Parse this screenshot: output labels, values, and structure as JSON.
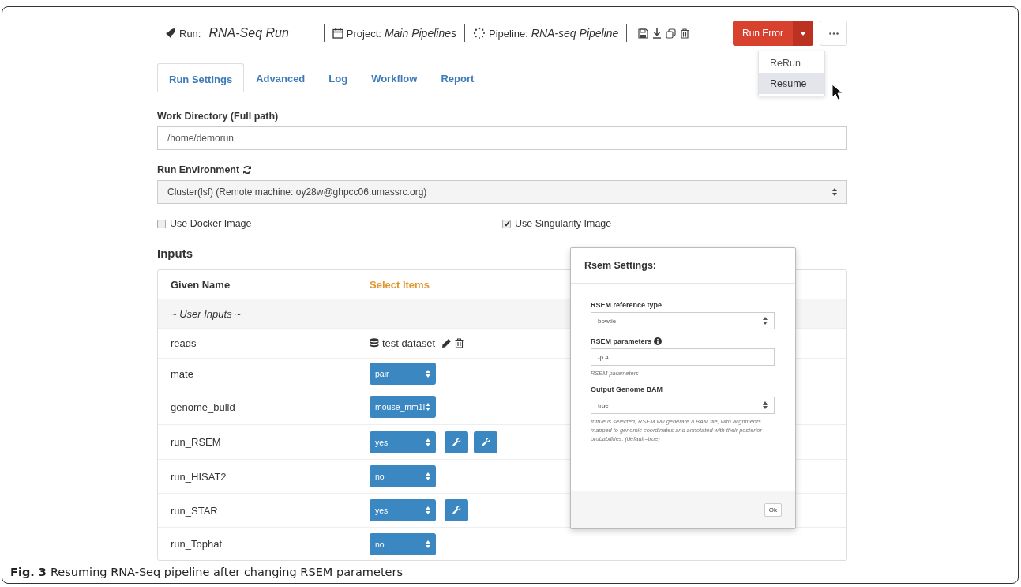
{
  "header": {
    "run_label": "Run:",
    "run_name": "RNA-Seq Run",
    "project_label": "Project:",
    "project_name": "Main Pipelines",
    "pipeline_label": "Pipeline:",
    "pipeline_name": "RNA-seq Pipeline"
  },
  "status_button": {
    "label": "Run Error"
  },
  "status_menu": {
    "expanded": true,
    "items": [
      {
        "label": "ReRun",
        "selected": false
      },
      {
        "label": "Resume",
        "selected": true
      }
    ]
  },
  "tabs": [
    {
      "label": "Run Settings",
      "selected": true
    },
    {
      "label": "Advanced",
      "selected": false
    },
    {
      "label": "Log",
      "selected": false
    },
    {
      "label": "Workflow",
      "selected": false
    },
    {
      "label": "Report",
      "selected": false
    }
  ],
  "work_directory": {
    "label": "Work Directory (Full path)",
    "value": "/home/demorun"
  },
  "run_environment": {
    "label": "Run Environment",
    "value": "Cluster(lsf) (Remote machine: oy28w@ghpcc06.umassrc.org)"
  },
  "options": [
    {
      "label": "Use Docker Image",
      "checked": false
    },
    {
      "label": "Use Singularity Image",
      "checked": true
    }
  ],
  "inputs": {
    "title": "Inputs",
    "columns": [
      "Given Name",
      "Select Items"
    ],
    "group": "~ User Inputs ~",
    "rows": [
      {
        "name": "reads",
        "kind": "dataset",
        "value": "test dataset"
      },
      {
        "name": "mate",
        "kind": "select",
        "value": "pair"
      },
      {
        "name": "genome_build",
        "kind": "select",
        "value": "mouse_mm1l"
      },
      {
        "name": "run_RSEM",
        "kind": "select",
        "value": "yes",
        "tools": [
          {
            "kind": "settings"
          },
          {
            "kind": "settings"
          }
        ]
      },
      {
        "name": "run_HISAT2",
        "kind": "select",
        "value": "no"
      },
      {
        "name": "run_STAR",
        "kind": "select",
        "value": "yes",
        "tools": [
          {
            "kind": "settings"
          }
        ]
      },
      {
        "name": "run_Tophat",
        "kind": "select",
        "value": "no"
      }
    ]
  },
  "modal": {
    "title": "Rsem Settings:",
    "ok": "Ok",
    "fields": [
      {
        "kind": "select",
        "label": "RSEM reference type",
        "value": "bowtie"
      },
      {
        "kind": "input",
        "label": "RSEM parameters",
        "info": true,
        "value": "-p 4",
        "help": "RSEM parameters"
      },
      {
        "kind": "select",
        "label": "Output Genome BAM",
        "value": "true",
        "help": "If true is selected, RSEM will generate a BAM file, with alignments mapped to genomic coordinates and annotated with their posterior probabilities. (default=true)"
      }
    ]
  },
  "caption": {
    "label": "Fig. 3",
    "text": "Resuming RNA-Seq pipeline after changing RSEM parameters"
  }
}
